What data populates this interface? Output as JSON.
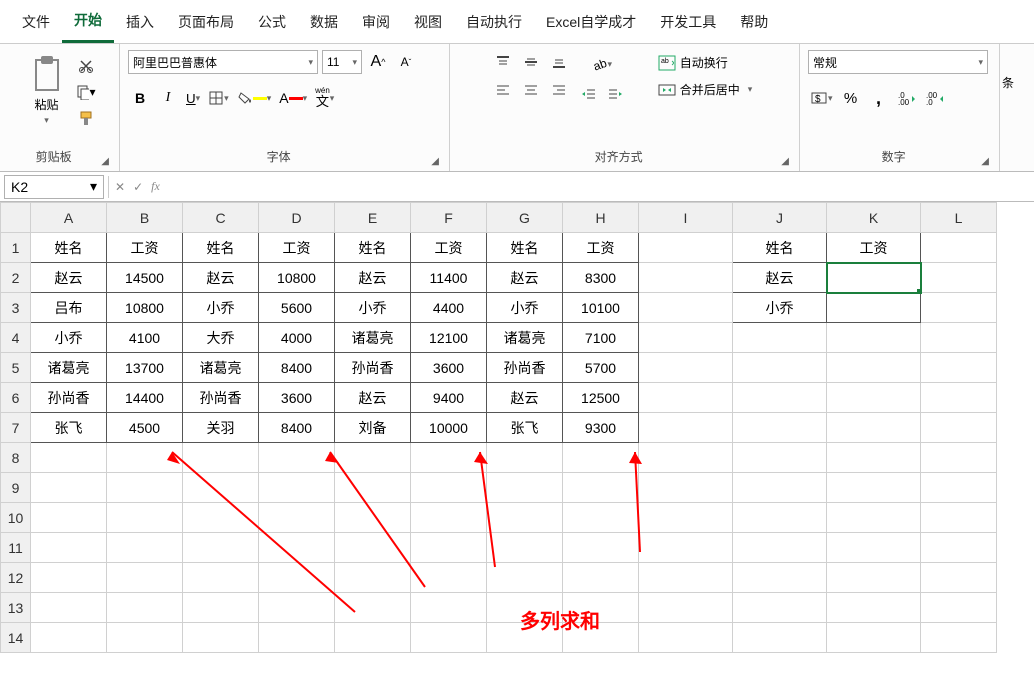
{
  "menu": {
    "items": [
      "文件",
      "开始",
      "插入",
      "页面布局",
      "公式",
      "数据",
      "审阅",
      "视图",
      "自动执行",
      "Excel自学成才",
      "开发工具",
      "帮助"
    ],
    "active_index": 1
  },
  "ribbon": {
    "clipboard": {
      "label": "剪贴板",
      "paste": "粘贴"
    },
    "font": {
      "label": "字体",
      "name": "阿里巴巴普惠体",
      "size": "11",
      "wen": "wén",
      "wen_char": "文"
    },
    "alignment": {
      "label": "对齐方式",
      "wrap": "自动换行",
      "merge": "合并后居中"
    },
    "number": {
      "label": "数字",
      "format": "常规"
    },
    "side": "条"
  },
  "namebox": "K2",
  "columns": [
    "A",
    "B",
    "C",
    "D",
    "E",
    "F",
    "G",
    "H",
    "I",
    "J",
    "K",
    "L"
  ],
  "rows": [
    "1",
    "2",
    "3",
    "4",
    "5",
    "6",
    "7",
    "8",
    "9",
    "10",
    "11",
    "12",
    "13",
    "14"
  ],
  "headers_main": [
    "姓名",
    "工资",
    "姓名",
    "工资",
    "姓名",
    "工资",
    "姓名",
    "工资"
  ],
  "data_main": [
    [
      "赵云",
      "14500",
      "赵云",
      "10800",
      "赵云",
      "11400",
      "赵云",
      "8300"
    ],
    [
      "吕布",
      "10800",
      "小乔",
      "5600",
      "小乔",
      "4400",
      "小乔",
      "10100"
    ],
    [
      "小乔",
      "4100",
      "大乔",
      "4000",
      "诸葛亮",
      "12100",
      "诸葛亮",
      "7100"
    ],
    [
      "诸葛亮",
      "13700",
      "诸葛亮",
      "8400",
      "孙尚香",
      "3600",
      "孙尚香",
      "5700"
    ],
    [
      "孙尚香",
      "14400",
      "孙尚香",
      "3600",
      "赵云",
      "9400",
      "赵云",
      "12500"
    ],
    [
      "张飞",
      "4500",
      "关羽",
      "8400",
      "刘备",
      "10000",
      "张飞",
      "9300"
    ]
  ],
  "lookup": {
    "headers": [
      "姓名",
      "工资"
    ],
    "rows": [
      [
        "赵云",
        ""
      ],
      [
        "小乔",
        ""
      ]
    ]
  },
  "annotation": "多列求和",
  "chart_data": {
    "type": "table",
    "title": "多列求和",
    "columns": [
      "姓名",
      "工资",
      "姓名",
      "工资",
      "姓名",
      "工资",
      "姓名",
      "工资"
    ],
    "rows": [
      [
        "赵云",
        14500,
        "赵云",
        10800,
        "赵云",
        11400,
        "赵云",
        8300
      ],
      [
        "吕布",
        10800,
        "小乔",
        5600,
        "小乔",
        4400,
        "小乔",
        10100
      ],
      [
        "小乔",
        4100,
        "大乔",
        4000,
        "诸葛亮",
        12100,
        "诸葛亮",
        7100
      ],
      [
        "诸葛亮",
        13700,
        "诸葛亮",
        8400,
        "孙尚香",
        3600,
        "孙尚香",
        5700
      ],
      [
        "孙尚香",
        14400,
        "孙尚香",
        3600,
        "赵云",
        9400,
        "赵云",
        12500
      ],
      [
        "张飞",
        4500,
        "关羽",
        8400,
        "刘备",
        10000,
        "张飞",
        9300
      ]
    ],
    "lookup": {
      "姓名": [
        "赵云",
        "小乔"
      ],
      "工资": [
        null,
        null
      ]
    }
  }
}
